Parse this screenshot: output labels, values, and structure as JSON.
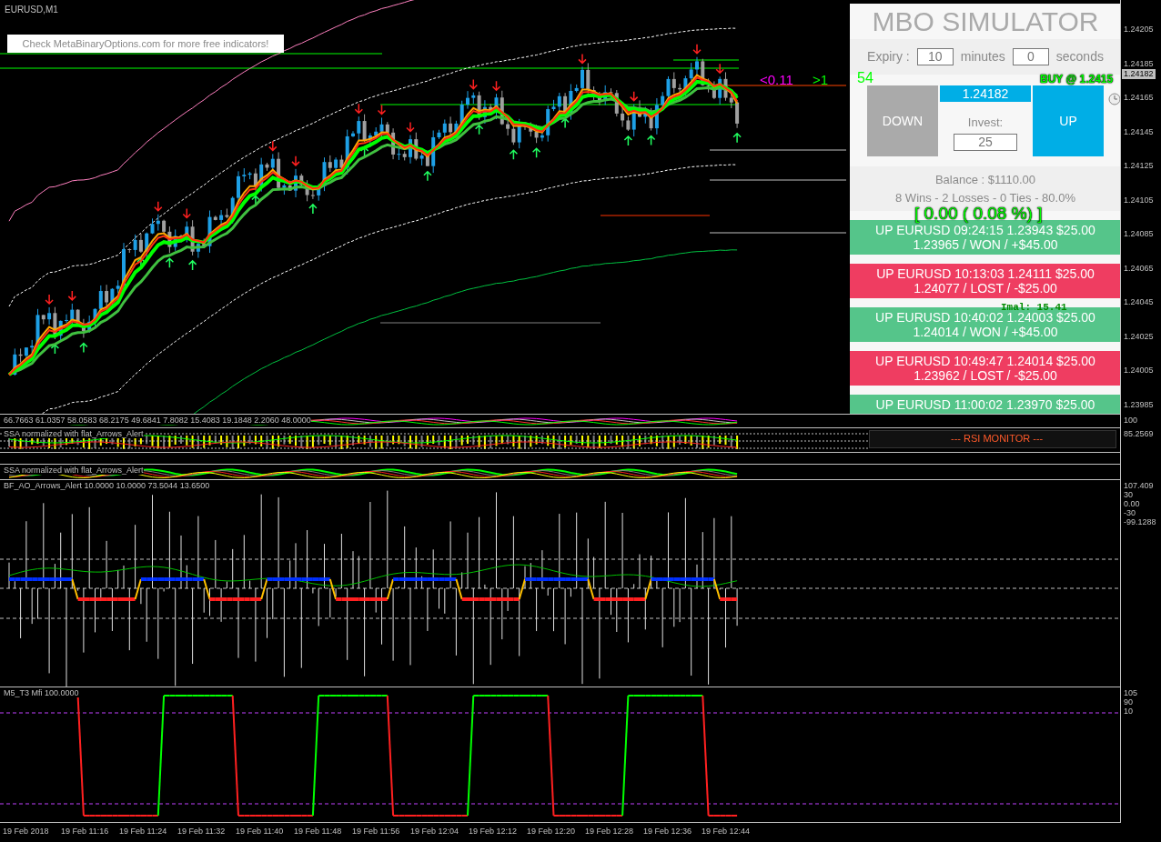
{
  "chart": {
    "symbol": "EURUSD,M1",
    "promo_button": "Check MetaBinaryOptions.com for more free indicators!",
    "counter": "54",
    "markers": [
      {
        "text": "<0.11",
        "color": "#ff00ff"
      },
      {
        "text": ">1",
        "color": "#00ff00"
      }
    ],
    "price_axis": [
      "1.24205",
      "1.24185",
      "1.24165",
      "1.24145",
      "1.24125",
      "1.24105",
      "1.24085",
      "1.24065",
      "1.24045",
      "1.24025",
      "1.24005",
      "1.23985"
    ],
    "current_price": "1.24182"
  },
  "simulator": {
    "title": "MBO SIMULATOR",
    "expiry_label": "Expiry :",
    "minutes_value": "10",
    "minutes_label": "minutes",
    "seconds_value": "0",
    "seconds_label": "seconds",
    "down_button": "DOWN",
    "price": "1.24182",
    "invest_label": "Invest:",
    "invest_value": "25",
    "up_button": "UP",
    "balance": "Balance : $1110.00",
    "stats": "8 Wins - 2 Losses - 0 Ties - 80.0%",
    "trades": [
      {
        "line1": "UP EURUSD 09:24:15 1.23943 $25.00",
        "line2": "1.23965 / WON / +$45.00",
        "color": "#55c58a"
      },
      {
        "line1": "UP EURUSD 10:13:03 1.24111 $25.00",
        "line2": "1.24077 / LOST / -$25.00",
        "color": "#ef3d61"
      },
      {
        "line1": "UP EURUSD 10:40:02 1.24003 $25.00",
        "line2": "1.24014 / WON / +$45.00",
        "color": "#55c58a"
      },
      {
        "line1": "UP EURUSD 10:49:47 1.24014 $25.00",
        "line2": "1.23962 / LOST / -$25.00",
        "color": "#ef3d61"
      },
      {
        "line1": "UP EURUSD 11:00:02 1.23970 $25.00",
        "color": "#55c58a"
      }
    ]
  },
  "overlays": {
    "signal": "BUY @ 1.2415",
    "profit": "[ 0.00 ( 0.08 %) ]",
    "imal": "Imal: 15.41"
  },
  "indicators": [
    {
      "label": "66.7663 61.0357 58.0583 68.2175 49.6841 7.8082 15.4083 19.1848 2.2060 48.0000",
      "axis": [
        "100"
      ]
    },
    {
      "label": "SSA normalized with flat_Arrows_Alert",
      "axis": [
        "85.2569"
      ],
      "monitor": "--- RSI MONITOR ---"
    },
    {
      "label": "SSA normalized with flat_Arrows_Alert"
    },
    {
      "label": "BF_AO_Arrows_Alert 10.0000 10.0000 73.5044 13.6500",
      "axis": [
        "107.409",
        "30",
        "0.00",
        "-30",
        "-99.1288"
      ]
    },
    {
      "label": "M5_T3 Mfi 100.0000",
      "axis": [
        "105",
        "90",
        "10"
      ]
    }
  ],
  "time_axis": [
    "19 Feb 2018",
    "19 Feb 11:16",
    "19 Feb 11:24",
    "19 Feb 11:32",
    "19 Feb 11:40",
    "19 Feb 11:48",
    "19 Feb 11:56",
    "19 Feb 12:04",
    "19 Feb 12:12",
    "19 Feb 12:20",
    "19 Feb 12:28",
    "19 Feb 12:36",
    "19 Feb 12:44"
  ]
}
